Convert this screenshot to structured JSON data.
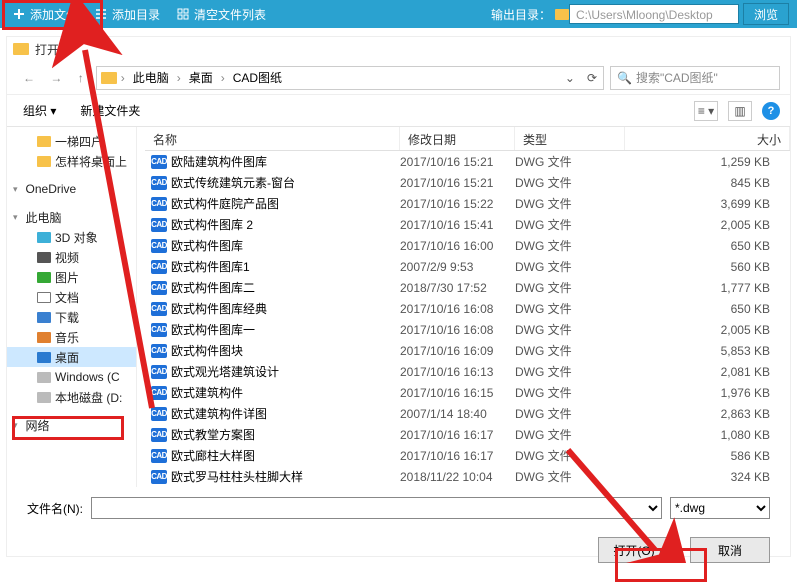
{
  "toolbar": {
    "add_file": "添加文件",
    "add_dir": "添加目录",
    "clear_list": "清空文件列表",
    "outdir_label": "输出目录：",
    "outdir_path": "C:\\Users\\Mloong\\Desktop",
    "browse": "浏览"
  },
  "dialog": {
    "title": "打开",
    "breadcrumbs": [
      "此电脑",
      "桌面",
      "CAD图纸"
    ],
    "search_placeholder": "搜索\"CAD图纸\"",
    "organize": "组织",
    "new_folder": "新建文件夹",
    "sidebar": {
      "recent": [
        "一梯四户",
        "怎样将桌面上"
      ],
      "onedrive": "OneDrive",
      "this_pc": "此电脑",
      "pc_children": [
        {
          "label": "3D 对象",
          "cls": "blue3d"
        },
        {
          "label": "视频",
          "cls": "video"
        },
        {
          "label": "图片",
          "cls": "pic"
        },
        {
          "label": "文档",
          "cls": "doc"
        },
        {
          "label": "下载",
          "cls": "dl"
        },
        {
          "label": "音乐",
          "cls": "music"
        },
        {
          "label": "桌面",
          "cls": "desk"
        },
        {
          "label": "Windows (C",
          "cls": "disk"
        },
        {
          "label": "本地磁盘 (D:",
          "cls": "disk"
        }
      ],
      "network": "网络"
    },
    "columns": {
      "name": "名称",
      "date": "修改日期",
      "type": "类型",
      "size": "大小"
    },
    "files": [
      {
        "name": "欧陆建筑构件图库",
        "date": "2017/10/16 15:21",
        "type": "DWG 文件",
        "size": "1,259 KB"
      },
      {
        "name": "欧式传统建筑元素-窗台",
        "date": "2017/10/16 15:21",
        "type": "DWG 文件",
        "size": "845 KB"
      },
      {
        "name": "欧式构件庭院产品图",
        "date": "2017/10/16 15:22",
        "type": "DWG 文件",
        "size": "3,699 KB"
      },
      {
        "name": "欧式构件图库 2",
        "date": "2017/10/16 15:41",
        "type": "DWG 文件",
        "size": "2,005 KB"
      },
      {
        "name": "欧式构件图库",
        "date": "2017/10/16 16:00",
        "type": "DWG 文件",
        "size": "650 KB"
      },
      {
        "name": "欧式构件图库1",
        "date": "2007/2/9 9:53",
        "type": "DWG 文件",
        "size": "560 KB"
      },
      {
        "name": "欧式构件图库二",
        "date": "2018/7/30 17:52",
        "type": "DWG 文件",
        "size": "1,777 KB"
      },
      {
        "name": "欧式构件图库经典",
        "date": "2017/10/16 16:08",
        "type": "DWG 文件",
        "size": "650 KB"
      },
      {
        "name": "欧式构件图库一",
        "date": "2017/10/16 16:08",
        "type": "DWG 文件",
        "size": "2,005 KB"
      },
      {
        "name": "欧式构件图块",
        "date": "2017/10/16 16:09",
        "type": "DWG 文件",
        "size": "5,853 KB"
      },
      {
        "name": "欧式观光塔建筑设计",
        "date": "2017/10/16 16:13",
        "type": "DWG 文件",
        "size": "2,081 KB"
      },
      {
        "name": "欧式建筑构件",
        "date": "2017/10/16 16:15",
        "type": "DWG 文件",
        "size": "1,976 KB"
      },
      {
        "name": "欧式建筑构件详图",
        "date": "2007/1/14 18:40",
        "type": "DWG 文件",
        "size": "2,863 KB"
      },
      {
        "name": "欧式教堂方案图",
        "date": "2017/10/16 16:17",
        "type": "DWG 文件",
        "size": "1,080 KB"
      },
      {
        "name": "欧式廊柱大样图",
        "date": "2017/10/16 16:17",
        "type": "DWG 文件",
        "size": "586 KB"
      },
      {
        "name": "欧式罗马柱柱头柱脚大样",
        "date": "2018/11/22 10:04",
        "type": "DWG 文件",
        "size": "324 KB"
      }
    ],
    "filename_label": "文件名(N):",
    "file_type_filter": "*.dwg",
    "open_btn": "打开(O)",
    "cancel_btn": "取消"
  }
}
